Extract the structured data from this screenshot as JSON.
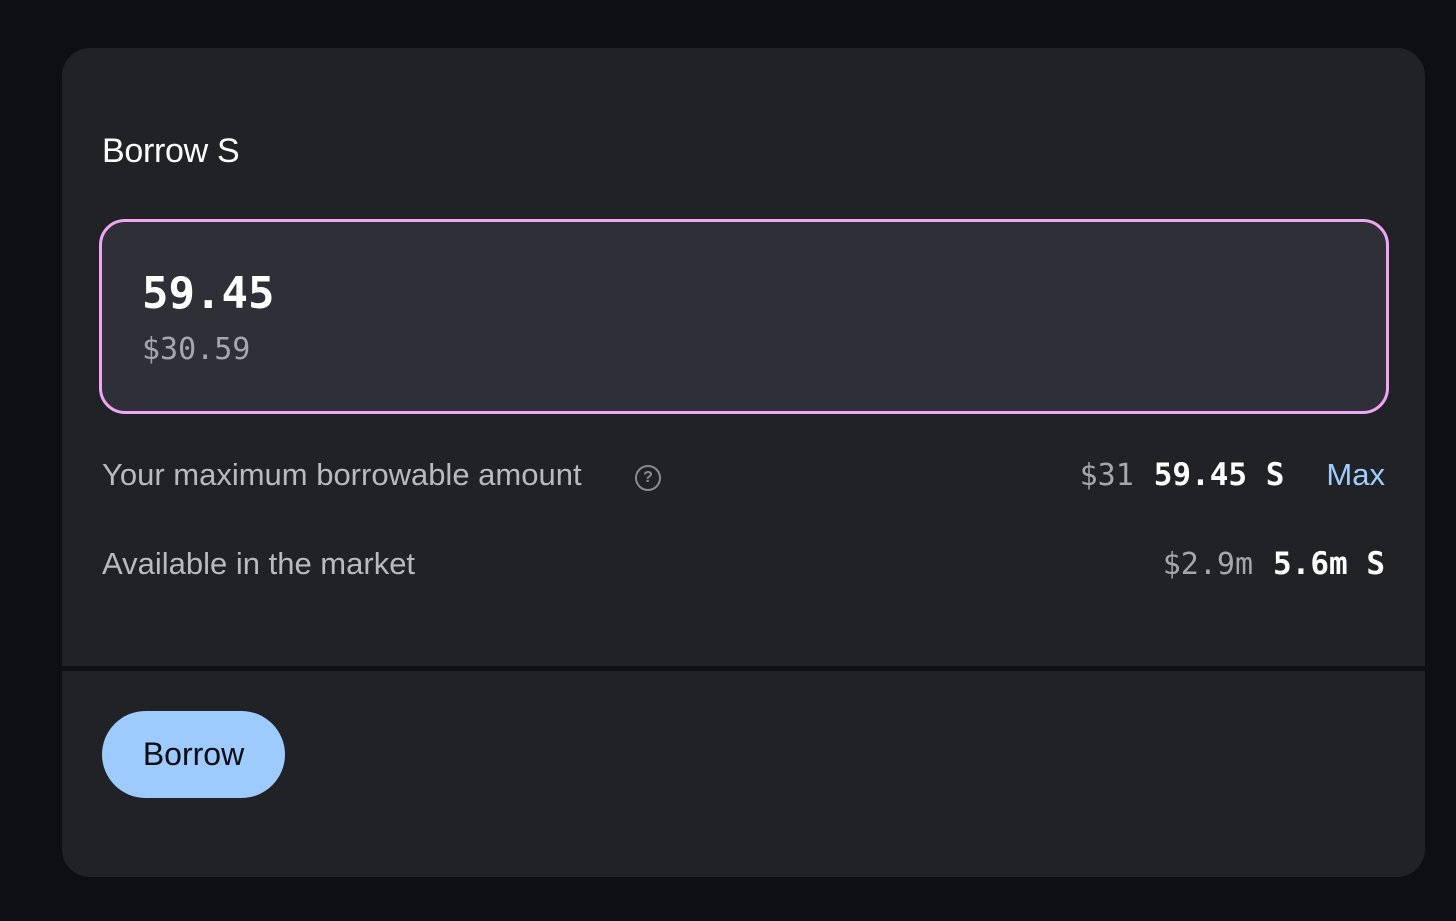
{
  "panel": {
    "title": "Borrow S"
  },
  "amount_input": {
    "value": "59.45",
    "usd_value": "$30.59"
  },
  "max_borrowable": {
    "label": "Your maximum borrowable amount",
    "help_icon": "question-circle-icon",
    "help_glyph": "?",
    "usd": "$31",
    "amount": "59.45 S",
    "max_label": "Max"
  },
  "market_available": {
    "label": "Available in the market",
    "usd": "$2.9m",
    "amount": "5.6m S"
  },
  "actions": {
    "borrow_label": "Borrow"
  },
  "colors": {
    "page_background": "#0e0f12",
    "card_background": "#212226",
    "input_background": "#2f3037",
    "input_focus_border": "#f0a6f2",
    "accent_blue": "#9dcbfd",
    "muted_text": "#a6a7ad"
  }
}
